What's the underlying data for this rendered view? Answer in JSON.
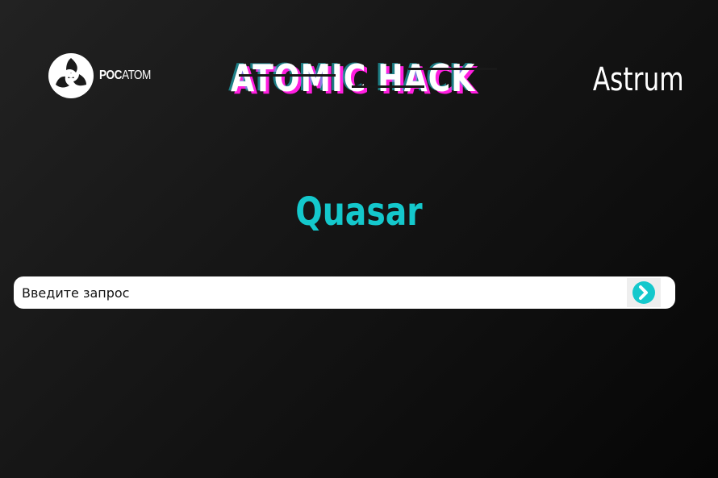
{
  "header": {
    "brand": {
      "logo_icon": "rosatom-logo-icon",
      "name_bold": "РОС",
      "name_regular": "АТОМ"
    },
    "event_title": "ATOMIC HACK",
    "team_name": "Astrum"
  },
  "main": {
    "product_title": "Quasar",
    "search": {
      "placeholder": "Введите запрос",
      "value": "",
      "submit_icon": "arrow-right-circle-icon"
    }
  },
  "colors": {
    "accent_cyan": "#14c8cc",
    "glitch_magenta": "#ff1ee0",
    "background_dark": "#151515",
    "text_white": "#ffffff"
  }
}
